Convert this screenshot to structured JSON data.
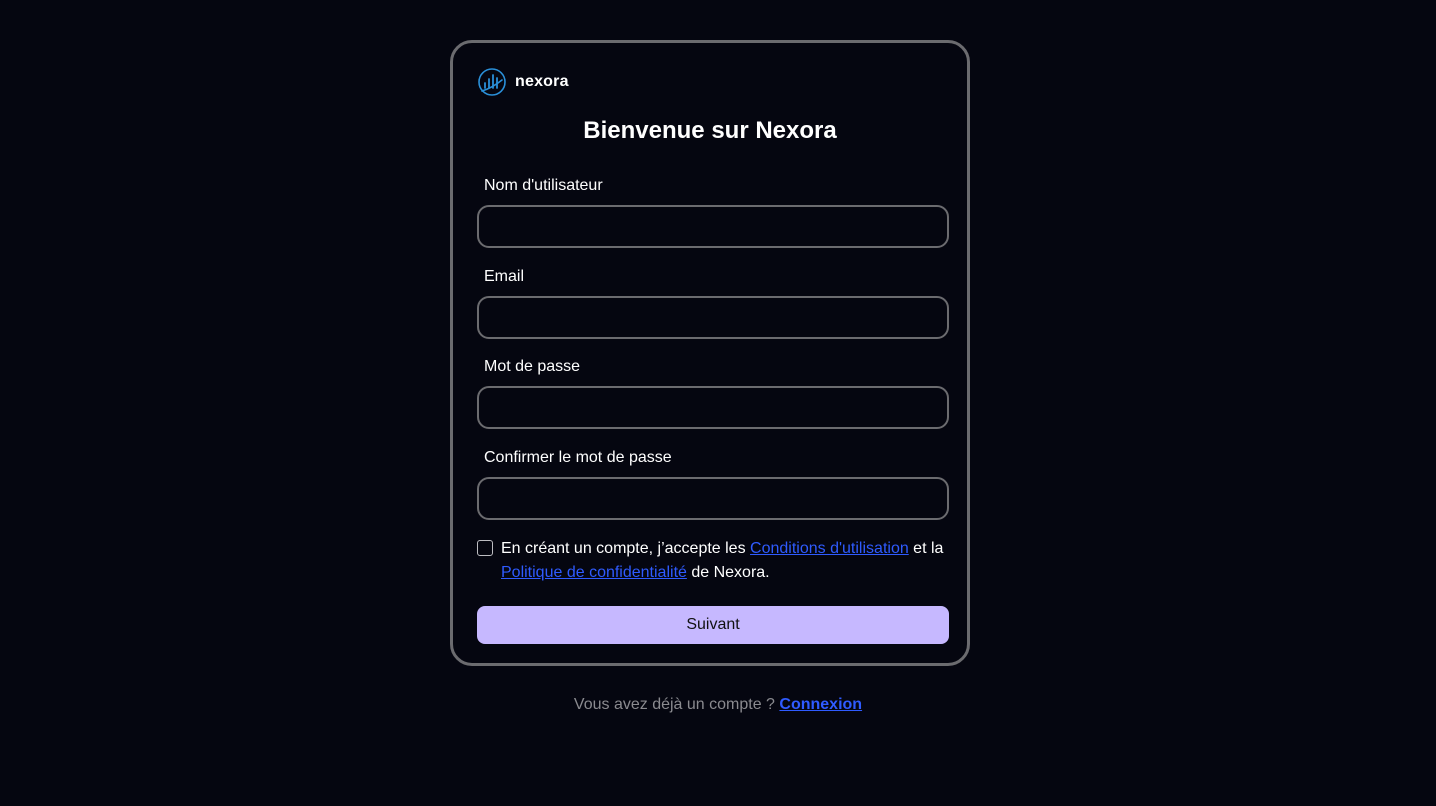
{
  "brand": {
    "name": "nexora",
    "logo_icon": "bar-chart-circle-icon",
    "accent_color": "#2a8fd8"
  },
  "form": {
    "title": "Bienvenue sur Nexora",
    "fields": {
      "username_label": "Nom d'utilisateur",
      "username_value": "",
      "email_label": "Email",
      "email_value": "",
      "password_label": "Mot de passe",
      "password_value": "",
      "confirm_label": "Confirmer le mot de passe",
      "confirm_value": ""
    },
    "consent": {
      "checked": false,
      "text_before": "En créant un compte, j’accepte les ",
      "terms_link": "Conditions d'utilisation",
      "text_middle": " et la ",
      "privacy_link": "Politique de confidentialité",
      "text_after": " de Nexora."
    },
    "submit_label": "Suivant"
  },
  "footer": {
    "text": "Vous avez déjà un compte ? ",
    "login_link": "Connexion"
  },
  "colors": {
    "background": "#050610",
    "border": "#6b6b6f",
    "button": "#c6b8ff",
    "link": "#2f5bff"
  }
}
